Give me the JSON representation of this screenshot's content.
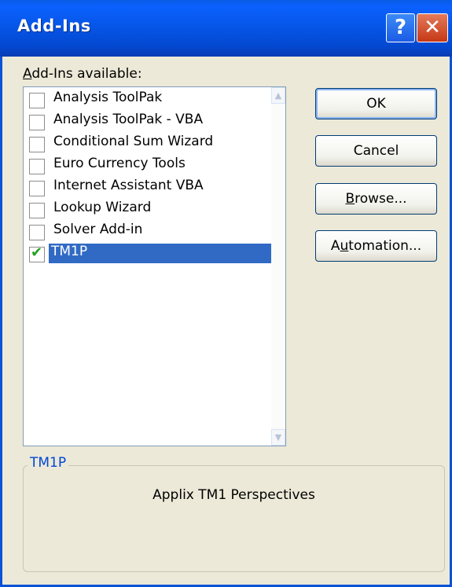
{
  "window": {
    "title": "Add-Ins",
    "help_glyph": "?",
    "close_glyph": "✕"
  },
  "list": {
    "label_prefix_underlined": "A",
    "label_rest": "dd-Ins available:",
    "items": [
      {
        "label": "Analysis ToolPak",
        "checked": false,
        "selected": false
      },
      {
        "label": "Analysis ToolPak - VBA",
        "checked": false,
        "selected": false
      },
      {
        "label": "Conditional Sum Wizard",
        "checked": false,
        "selected": false
      },
      {
        "label": "Euro Currency Tools",
        "checked": false,
        "selected": false
      },
      {
        "label": "Internet Assistant VBA",
        "checked": false,
        "selected": false
      },
      {
        "label": "Lookup Wizard",
        "checked": false,
        "selected": false
      },
      {
        "label": "Solver Add-in",
        "checked": false,
        "selected": false
      },
      {
        "label": "TM1P",
        "checked": true,
        "selected": true
      }
    ]
  },
  "buttons": {
    "ok": "OK",
    "cancel": "Cancel",
    "browse_underlined": "B",
    "browse_rest": "rowse...",
    "automation_prefix": "A",
    "automation_underlined": "u",
    "automation_rest": "tomation..."
  },
  "details": {
    "group_title": "TM1P",
    "description": "Applix TM1 Perspectives"
  },
  "colors": {
    "titlebar": "#0a5be6",
    "selection": "#316ac5",
    "group_title": "#0046d5",
    "check": "#21a121"
  }
}
